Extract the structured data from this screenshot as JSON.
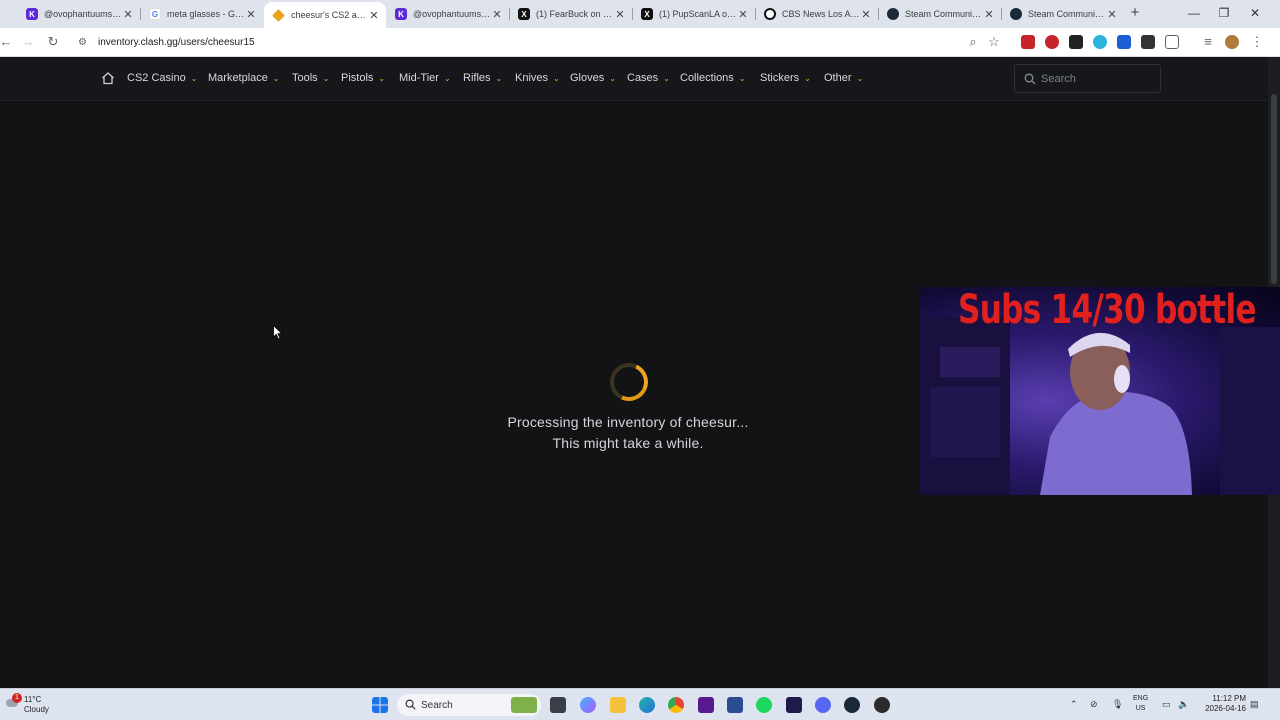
{
  "browser": {
    "tabs": [
      {
        "title": "@ovophantuums on",
        "icon": "kick-icon"
      },
      {
        "title": "meta glasses - Googl",
        "icon": "google-icon"
      },
      {
        "title": "cheesur's CS2 and CS",
        "icon": "clash-icon"
      },
      {
        "title": "@ovophantuums on",
        "icon": "kick-icon"
      },
      {
        "title": "(1) FearBuck on X: \"D",
        "icon": "x-icon"
      },
      {
        "title": "(1) PupScanLA on X:",
        "icon": "x-icon"
      },
      {
        "title": "CBS News Los Angele",
        "icon": "cbs-icon"
      },
      {
        "title": "Steam Community M",
        "icon": "steam-icon"
      },
      {
        "title": "Steam Community M",
        "icon": "steam-icon"
      }
    ],
    "url": "inventory.clash.gg/users/cheesur15"
  },
  "nav": {
    "items": [
      {
        "label": "CS2 Casino"
      },
      {
        "label": "Marketplace"
      },
      {
        "label": "Tools"
      },
      {
        "label": "Pistols"
      },
      {
        "label": "Mid-Tier"
      },
      {
        "label": "Rifles"
      },
      {
        "label": "Knives"
      },
      {
        "label": "Gloves"
      },
      {
        "label": "Cases"
      },
      {
        "label": "Collections"
      },
      {
        "label": "Stickers"
      },
      {
        "label": "Other"
      }
    ],
    "search_placeholder": "Search"
  },
  "main": {
    "message_line1": "Processing the inventory of cheesur...",
    "message_line2": "This might take a while.",
    "accent_color": "#f0a521"
  },
  "webcam": {
    "banner": "Subs 14/30 bottle"
  },
  "taskbar": {
    "weather_temp": "11°C",
    "weather_cond": "Cloudy",
    "weather_badge": "1",
    "search_label": "Search",
    "lang_line1": "ENG",
    "lang_line2": "US",
    "time": "11:12 PM",
    "date": "2026-04-16"
  }
}
